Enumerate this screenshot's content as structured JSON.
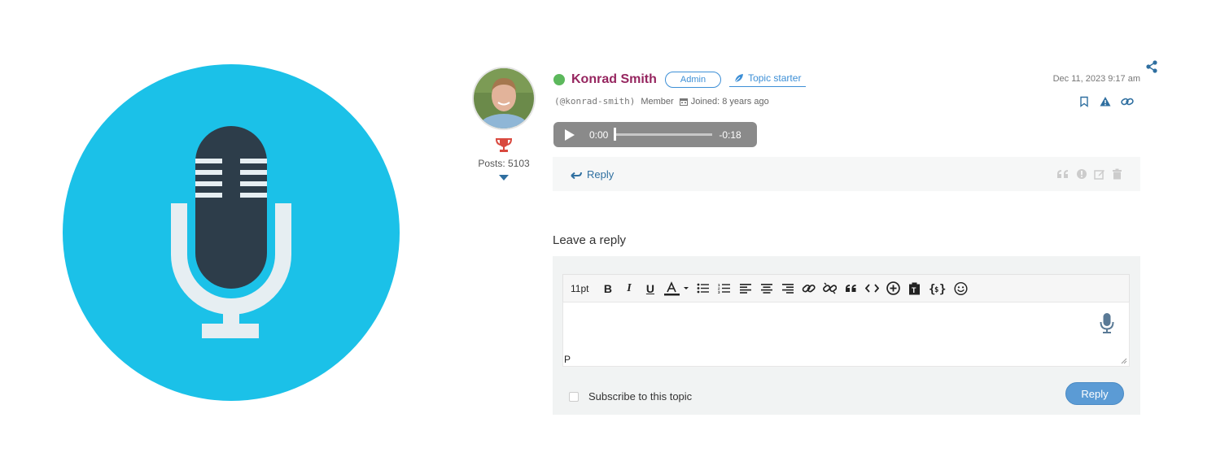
{
  "author": {
    "name": "Konrad Smith",
    "handle": "(@konrad-smith)",
    "role": "Member",
    "joined": "Joined: 8 years ago",
    "status": "online",
    "admin_badge": "Admin",
    "starter_badge": "Topic starter",
    "posts": "Posts: 5103"
  },
  "post": {
    "date": "Dec 11, 2023 9:17 am",
    "audio": {
      "current": "0:00",
      "remaining": "-0:18",
      "progress": 0
    },
    "reply_label": "Reply"
  },
  "reply_form": {
    "title": "Leave a reply",
    "font_size": "11pt",
    "path_tag": "P",
    "subscribe_label": "Subscribe to this topic",
    "submit_label": "Reply"
  },
  "colors": {
    "hero_circle": "#1bc1e8",
    "mic_body": "#2d3d4a",
    "author_name": "#96255f",
    "online": "#5cb85c",
    "link": "#2f6fa0",
    "button": "#5b9bd5"
  },
  "icons": {
    "hero": "microphone-icon",
    "trophy": "trophy-icon",
    "share": "share-icon",
    "bookmark": "bookmark-icon",
    "report": "warning-icon",
    "link": "link-icon"
  }
}
